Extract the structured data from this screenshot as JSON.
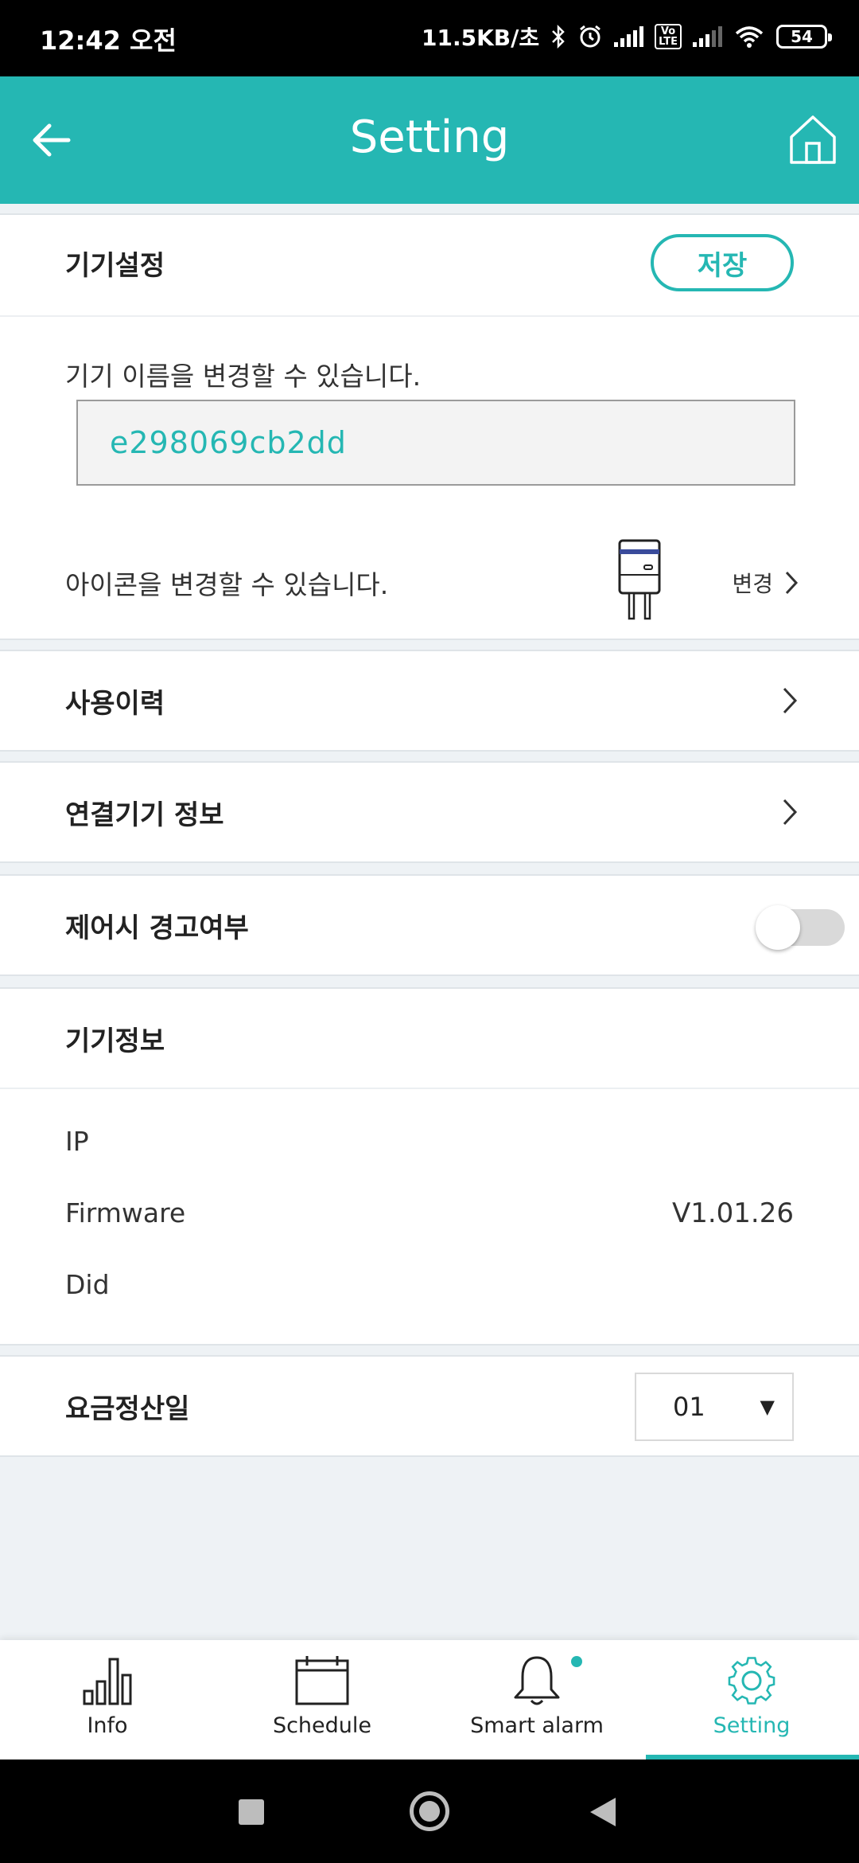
{
  "status_bar": {
    "time": "12:42 오전",
    "net_speed": "11.5KB/초",
    "volte": "Vo\nLTE",
    "battery": "54"
  },
  "header": {
    "title": "Setting",
    "back_icon": "arrow-left-icon",
    "home_icon": "home-icon"
  },
  "device_settings": {
    "title": "기기설정",
    "save_label": "저장",
    "name_helper": "기기 이름을 변경할 수 있습니다.",
    "device_name": "e298069cb2dd",
    "icon_helper": "아이콘을 변경할 수 있습니다.",
    "change_label": "변경"
  },
  "usage_history": {
    "title": "사용이력"
  },
  "connected_device": {
    "title": "연결기기 정보"
  },
  "control_warning": {
    "title": "제어시 경고여부",
    "enabled": false
  },
  "device_info": {
    "title": "기기정보",
    "rows": [
      {
        "label": "IP",
        "value": ""
      },
      {
        "label": "Firmware",
        "value": "V1.01.26"
      },
      {
        "label": "Did",
        "value": ""
      }
    ]
  },
  "billing_day": {
    "title": "요금정산일",
    "selected": "01"
  },
  "bottom_nav": {
    "items": [
      {
        "label": "Info",
        "icon": "bar-chart-icon",
        "active": false
      },
      {
        "label": "Schedule",
        "icon": "calendar-icon",
        "active": false
      },
      {
        "label": "Smart alarm",
        "icon": "bell-icon",
        "active": false,
        "badge": true
      },
      {
        "label": "Setting",
        "icon": "gear-icon",
        "active": true
      }
    ],
    "accent_color": "#25b7b3"
  },
  "colors": {
    "primary": "#25b7b3",
    "background": "#eef2f5"
  }
}
